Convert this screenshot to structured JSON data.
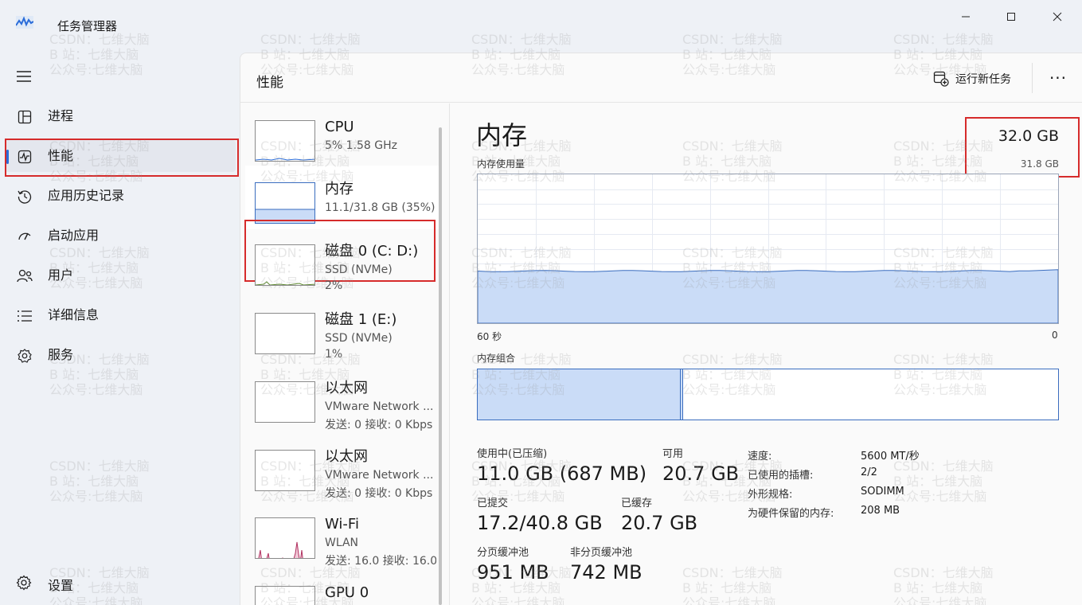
{
  "window": {
    "title": "任务管理器"
  },
  "nav": {
    "items": [
      {
        "id": "processes",
        "label": "进程",
        "icon": "processes-icon"
      },
      {
        "id": "performance",
        "label": "性能",
        "icon": "performance-icon",
        "active": true
      },
      {
        "id": "app-history",
        "label": "应用历史记录",
        "icon": "history-icon"
      },
      {
        "id": "startup",
        "label": "启动应用",
        "icon": "startup-icon"
      },
      {
        "id": "users",
        "label": "用户",
        "icon": "users-icon"
      },
      {
        "id": "details",
        "label": "详细信息",
        "icon": "details-icon"
      },
      {
        "id": "services",
        "label": "服务",
        "icon": "services-icon"
      }
    ],
    "settings_label": "设置"
  },
  "header": {
    "title": "性能",
    "run_task_label": "运行新任务",
    "more_label": "···"
  },
  "resources": [
    {
      "name": "CPU",
      "sub1": "5% 1.58 GHz",
      "sub2": ""
    },
    {
      "name": "内存",
      "sub1": "11.1/31.8 GB (35%)",
      "sub2": "",
      "active": true
    },
    {
      "name": "磁盘 0 (C: D:)",
      "sub1": "SSD (NVMe)",
      "sub2": "2%"
    },
    {
      "name": "磁盘 1 (E:)",
      "sub1": "SSD (NVMe)",
      "sub2": "1%"
    },
    {
      "name": "以太网",
      "sub1": "VMware Network ...",
      "sub2": "发送: 0 接收: 0 Kbps"
    },
    {
      "name": "以太网",
      "sub1": "VMware Network ...",
      "sub2": "发送: 0 接收: 0 Kbps"
    },
    {
      "name": "Wi-Fi",
      "sub1": "WLAN",
      "sub2": "发送: 16.0 接收: 16.0"
    },
    {
      "name": "GPU 0",
      "sub1": "",
      "sub2": ""
    }
  ],
  "detail": {
    "title": "内存",
    "total": "32.0 GB",
    "total_sub": "31.8 GB",
    "usage_label": "内存使用量",
    "axis_left": "60 秒",
    "axis_right": "0",
    "composition_label": "内存组合",
    "usage_fraction": 0.35,
    "stats": {
      "in_use_label": "使用中(已压缩)",
      "in_use_value": "11.0 GB (687 MB)",
      "available_label": "可用",
      "available_value": "20.7 GB",
      "committed_label": "已提交",
      "committed_value": "17.2/40.8 GB",
      "cached_label": "已缓存",
      "cached_value": "20.7 GB",
      "paged_label": "分页缓冲池",
      "paged_value": "951 MB",
      "nonpaged_label": "非分页缓冲池",
      "nonpaged_value": "742 MB"
    },
    "specs": [
      {
        "label": "速度:",
        "value": "5600 MT/秒"
      },
      {
        "label": "已使用的插槽:",
        "value": "2/2"
      },
      {
        "label": "外形规格:",
        "value": "SODIMM"
      },
      {
        "label": "为硬件保留的内存:",
        "value": "208 MB"
      }
    ]
  },
  "watermark": {
    "line1": "CSDN：七维大脑",
    "line2": "B 站：七维大脑",
    "line3": "公众号:七维大脑"
  },
  "colors": {
    "accent": "#2a6cd9",
    "highlight": "#d62b2b",
    "memory_fill": "#cadcf7",
    "memory_line": "#3a6dbf",
    "wifi_line": "#b0305f"
  }
}
